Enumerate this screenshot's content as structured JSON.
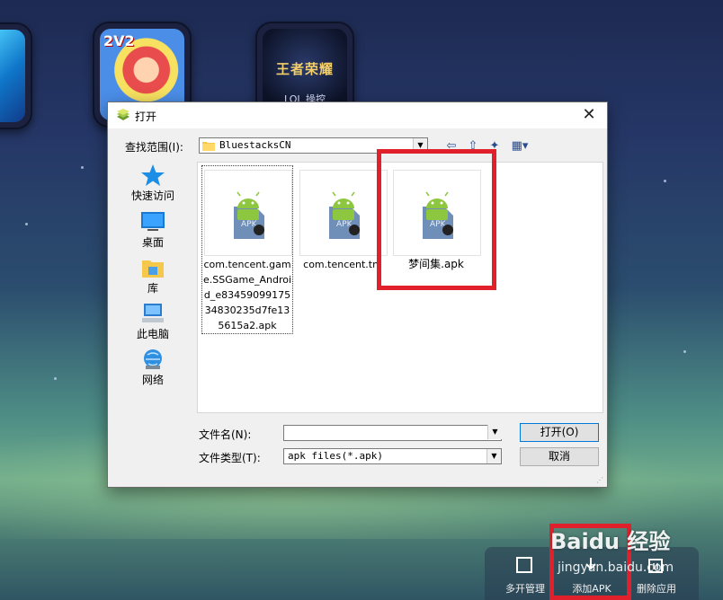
{
  "desktop": {
    "apps": [
      {
        "name": "",
        "label": ""
      },
      {
        "name": "2v2",
        "label": "2V2"
      },
      {
        "name": "王者荣耀",
        "label": "王者荣耀",
        "sub": "LOL 操控"
      }
    ]
  },
  "dialog": {
    "title": "打开",
    "lookin_label": "查找范围(I):",
    "lookin_value": "BluestacksCN",
    "places": [
      {
        "label": "快速访问",
        "icon": "star-icon"
      },
      {
        "label": "桌面",
        "icon": "desktop-icon"
      },
      {
        "label": "库",
        "icon": "library-icon"
      },
      {
        "label": "此电脑",
        "icon": "computer-icon"
      },
      {
        "label": "网络",
        "icon": "network-icon"
      }
    ],
    "files": [
      {
        "name": "com.tencent.game.SSGame_Android_e8345909917534830235d7fe135615a2.apk",
        "icon": "apk-android-icon"
      },
      {
        "name": "com.tencent.tm",
        "icon": "apk-android-icon"
      },
      {
        "name": "梦间集.apk",
        "icon": "apk-android-icon"
      }
    ],
    "filename_label": "文件名(N):",
    "filename_value": "",
    "filetype_label": "文件类型(T):",
    "filetype_value": "apk files(*.apk)",
    "open_button": "打开(O)",
    "cancel_button": "取消"
  },
  "bottombar": {
    "items": [
      {
        "label": "多开管理",
        "icon": "multi-instance-icon"
      },
      {
        "label": "添加APK",
        "icon": "add-apk-icon"
      },
      {
        "label": "删除应用",
        "icon": "delete-app-icon"
      }
    ]
  },
  "watermark": {
    "text": "Baidu 经验",
    "url": "jingyan.baidu.com"
  },
  "colors": {
    "highlight": "#e0202a",
    "android_green": "#8dc63f",
    "apk_blue": "#6f8fb8"
  }
}
